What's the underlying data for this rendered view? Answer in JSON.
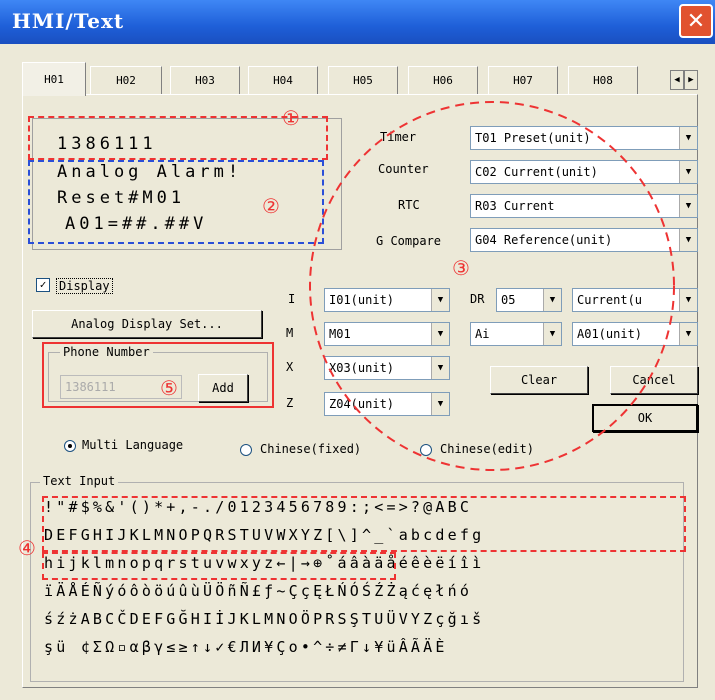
{
  "window": {
    "title": "HMI/Text",
    "close": "✕"
  },
  "tabs": [
    "H01",
    "H02",
    "H03",
    "H04",
    "H05",
    "H06",
    "H07",
    "H08"
  ],
  "lcd": {
    "lines": [
      "1386111",
      "Analog Alarm!",
      "Reset#M01",
      " A01=##.##V"
    ]
  },
  "right": {
    "timer": {
      "label": "Timer",
      "value": "T01 Preset(unit)"
    },
    "counter": {
      "label": "Counter",
      "value": "C02 Current(unit)"
    },
    "rtc": {
      "label": "RTC",
      "value": "R03 Current"
    },
    "gcompare": {
      "label": "G Compare",
      "value": "G04 Reference(unit)"
    }
  },
  "display_label": "Display",
  "analog_button": "Analog Display Set...",
  "phone": {
    "label": "Phone Number",
    "value": "1386111",
    "add": "Add"
  },
  "io": {
    "i": {
      "label": "I",
      "value": "I01(unit)"
    },
    "m": {
      "label": "M",
      "value": "M01"
    },
    "x": {
      "label": "X",
      "value": "X03(unit)"
    },
    "z": {
      "label": "Z",
      "value": "Z04(unit)"
    },
    "dr": {
      "label": "DR",
      "num": "05",
      "type": "Current(u"
    },
    "ai": {
      "value": "Ai",
      "sel": "A01(unit)"
    }
  },
  "buttons": {
    "clear": "Clear",
    "cancel": "Cancel",
    "ok": "OK"
  },
  "language": {
    "multi": "Multi Language",
    "fixed": "Chinese(fixed)",
    "edit": "Chinese(edit)"
  },
  "text_input": {
    "label": "Text Input",
    "rows": [
      " !\"#$%&'()*+,-./0123456789:;<=>?@ABC",
      "DEFGHIJKLMNOPQRSTUVWXYZ[\\]^_`abcdefg",
      "hijklmnopqrstuvwxyz←|→⊕˚áâàäåéêèëíîì",
      "ïÄÅÉÑýóôòöúûùÜÖñÑ£ƒ~ÇçĘŁŃÓŚŹŻąćęłńó",
      "śźżABCČDEFGĞHIİJKLMNOÖPRSŞTUÜVYZçğıš",
      "şü  ¢ΣΩ▫αβγ≤≥↑↓✓€ЛИ¥Ço•^÷≠Γ↓¥üÂÃÄÈ"
    ]
  },
  "markers": [
    "①",
    "②",
    "③",
    "④",
    "⑤"
  ]
}
